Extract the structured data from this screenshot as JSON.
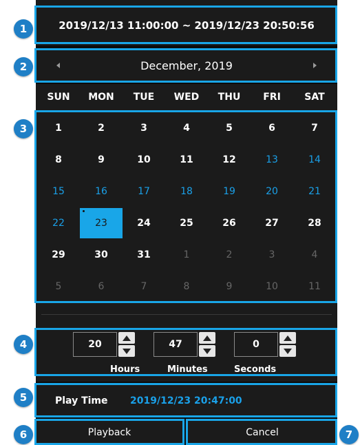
{
  "callouts": [
    "1",
    "2",
    "3",
    "4",
    "5",
    "6",
    "7"
  ],
  "range_text": "2019/12/13 11:00:00 ~ 2019/12/23 20:50:56",
  "month_title": "December, 2019",
  "weekdays": [
    "SUN",
    "MON",
    "TUE",
    "WED",
    "THU",
    "FRI",
    "SAT"
  ],
  "days": [
    {
      "n": "1",
      "t": "cur"
    },
    {
      "n": "2",
      "t": "cur"
    },
    {
      "n": "3",
      "t": "cur"
    },
    {
      "n": "4",
      "t": "cur"
    },
    {
      "n": "5",
      "t": "cur"
    },
    {
      "n": "6",
      "t": "cur"
    },
    {
      "n": "7",
      "t": "cur"
    },
    {
      "n": "8",
      "t": "cur"
    },
    {
      "n": "9",
      "t": "cur"
    },
    {
      "n": "10",
      "t": "cur"
    },
    {
      "n": "11",
      "t": "cur"
    },
    {
      "n": "12",
      "t": "cur"
    },
    {
      "n": "13",
      "t": "rec"
    },
    {
      "n": "14",
      "t": "rec"
    },
    {
      "n": "15",
      "t": "rec"
    },
    {
      "n": "16",
      "t": "rec"
    },
    {
      "n": "17",
      "t": "rec"
    },
    {
      "n": "18",
      "t": "rec"
    },
    {
      "n": "19",
      "t": "rec"
    },
    {
      "n": "20",
      "t": "rec"
    },
    {
      "n": "21",
      "t": "rec"
    },
    {
      "n": "22",
      "t": "rec"
    },
    {
      "n": "23",
      "t": "sel"
    },
    {
      "n": "24",
      "t": "cur"
    },
    {
      "n": "25",
      "t": "cur"
    },
    {
      "n": "26",
      "t": "cur"
    },
    {
      "n": "27",
      "t": "cur"
    },
    {
      "n": "28",
      "t": "cur"
    },
    {
      "n": "29",
      "t": "cur"
    },
    {
      "n": "30",
      "t": "cur"
    },
    {
      "n": "31",
      "t": "cur"
    },
    {
      "n": "1",
      "t": "other"
    },
    {
      "n": "2",
      "t": "other"
    },
    {
      "n": "3",
      "t": "other"
    },
    {
      "n": "4",
      "t": "other"
    },
    {
      "n": "5",
      "t": "other"
    },
    {
      "n": "6",
      "t": "other"
    },
    {
      "n": "7",
      "t": "other"
    },
    {
      "n": "8",
      "t": "other"
    },
    {
      "n": "9",
      "t": "other"
    },
    {
      "n": "10",
      "t": "other"
    },
    {
      "n": "11",
      "t": "other"
    }
  ],
  "time": {
    "hours": {
      "value": "20",
      "label": "Hours"
    },
    "minutes": {
      "value": "47",
      "label": "Minutes"
    },
    "seconds": {
      "value": "0",
      "label": "Seconds"
    }
  },
  "play_time": {
    "label": "Play Time",
    "value": "2019/12/23 20:47:00"
  },
  "buttons": {
    "playback": "Playback",
    "cancel": "Cancel"
  },
  "colors": {
    "accent": "#19a6e8",
    "panel": "#1b1b1b",
    "callout": "#1f7fc6"
  },
  "icons": {
    "prev": "chevron-left-icon",
    "next": "chevron-right-icon",
    "up": "triangle-up-icon",
    "down": "triangle-down-icon"
  }
}
